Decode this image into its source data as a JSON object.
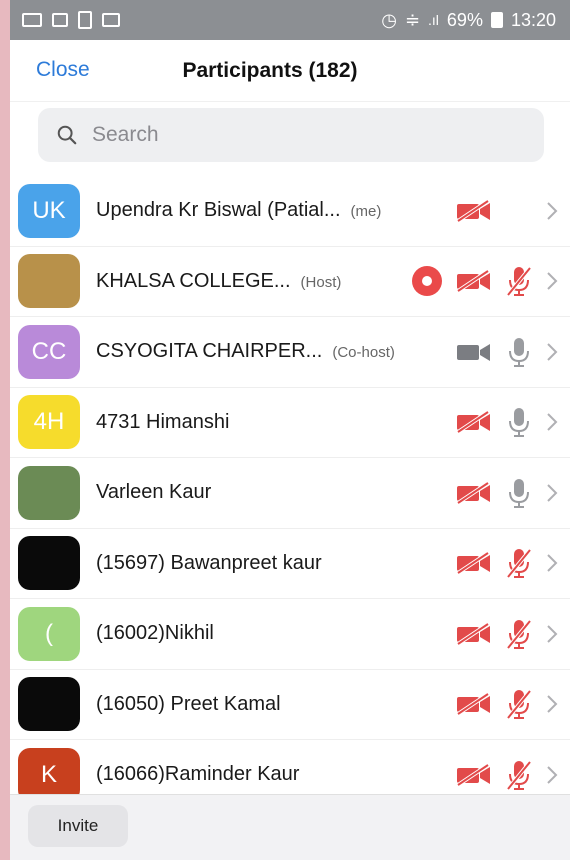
{
  "status_bar": {
    "battery": "69%",
    "time": "13:20"
  },
  "header": {
    "close_label": "Close",
    "title": "Participants (182)"
  },
  "search": {
    "placeholder": "Search"
  },
  "colors": {
    "accent": "#2d7bd9",
    "muted_red": "#e24a4a",
    "status_bar": "#8c8f93"
  },
  "participants": [
    {
      "avatar_text": "UK",
      "avatar_color": "#4aa3ea",
      "name": "Upendra Kr Biswal (Patial...",
      "role": "(me)",
      "recording": false,
      "video": "off",
      "mic": "none"
    },
    {
      "avatar_text": "",
      "avatar_color": "#b8914a",
      "name": "KHALSA COLLEGE...",
      "role": "(Host)",
      "recording": true,
      "video": "off",
      "mic": "muted"
    },
    {
      "avatar_text": "CC",
      "avatar_color": "#b98ad9",
      "name": "CSYOGITA CHAIRPER...",
      "role": "(Co-host)",
      "recording": false,
      "video": "on",
      "mic": "on"
    },
    {
      "avatar_text": "4H",
      "avatar_color": "#f6dc2c",
      "name": "4731 Himanshi",
      "role": "",
      "recording": false,
      "video": "off",
      "mic": "on"
    },
    {
      "avatar_text": "",
      "avatar_color": "#6b8b55",
      "name": "Varleen Kaur",
      "role": "",
      "recording": false,
      "video": "off",
      "mic": "on"
    },
    {
      "avatar_text": "",
      "avatar_color": "#0a0a0a",
      "name": "(15697) Bawanpreet kaur",
      "role": "",
      "recording": false,
      "video": "off",
      "mic": "muted"
    },
    {
      "avatar_text": "(",
      "avatar_color": "#9fd67e",
      "name": "(16002)Nikhil",
      "role": "",
      "recording": false,
      "video": "off",
      "mic": "muted"
    },
    {
      "avatar_text": "",
      "avatar_color": "#0a0a0a",
      "name": "(16050) Preet Kamal",
      "role": "",
      "recording": false,
      "video": "off",
      "mic": "muted"
    },
    {
      "avatar_text": "K",
      "avatar_color": "#c8401e",
      "name": "(16066)Raminder Kaur",
      "role": "",
      "recording": false,
      "video": "off",
      "mic": "muted"
    }
  ],
  "footer": {
    "invite_label": "Invite"
  }
}
